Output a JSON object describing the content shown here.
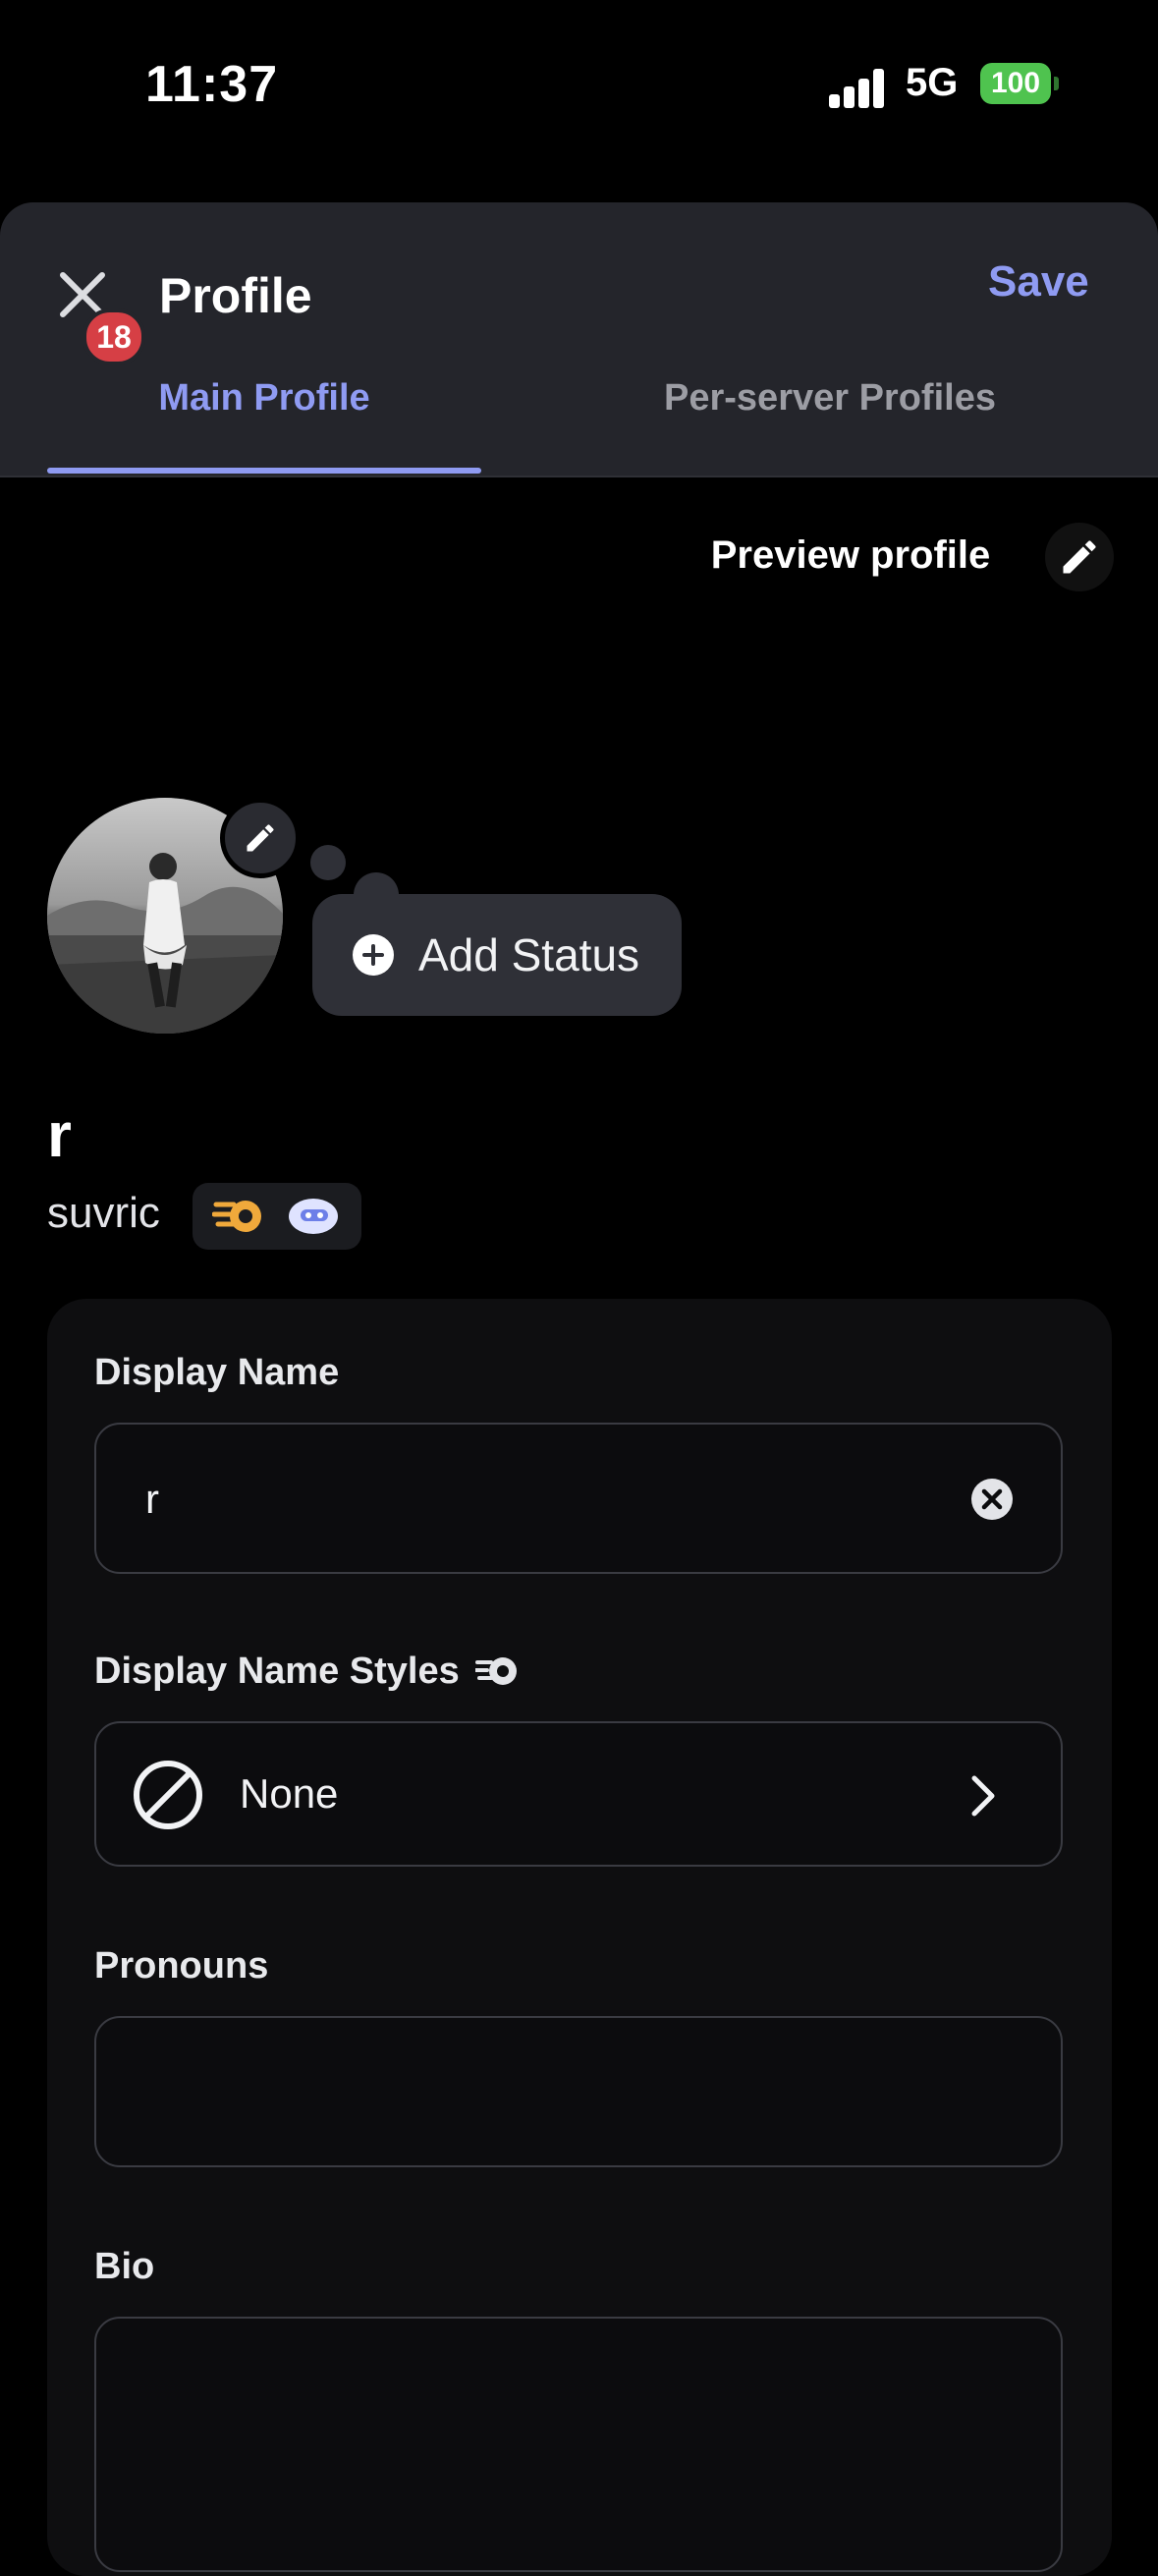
{
  "status_bar": {
    "time": "11:37",
    "network": "5G",
    "battery": "100"
  },
  "header": {
    "title": "Profile",
    "save_label": "Save",
    "notification_count": "18",
    "tabs": [
      {
        "label": "Main Profile",
        "active": true
      },
      {
        "label": "Per-server Profiles",
        "active": false
      }
    ]
  },
  "preview": {
    "label": "Preview profile"
  },
  "status": {
    "add_label": "Add Status"
  },
  "user": {
    "display_name": "r",
    "username": "suvric"
  },
  "form": {
    "display_name": {
      "label": "Display Name",
      "value": "r"
    },
    "display_name_styles": {
      "label": "Display Name Styles",
      "value": "None"
    },
    "pronouns": {
      "label": "Pronouns",
      "value": ""
    },
    "bio": {
      "label": "Bio",
      "value": ""
    }
  },
  "colors": {
    "accent": "#8f9bf2",
    "badge_red": "#d63f45",
    "battery_green": "#4fc34f"
  }
}
